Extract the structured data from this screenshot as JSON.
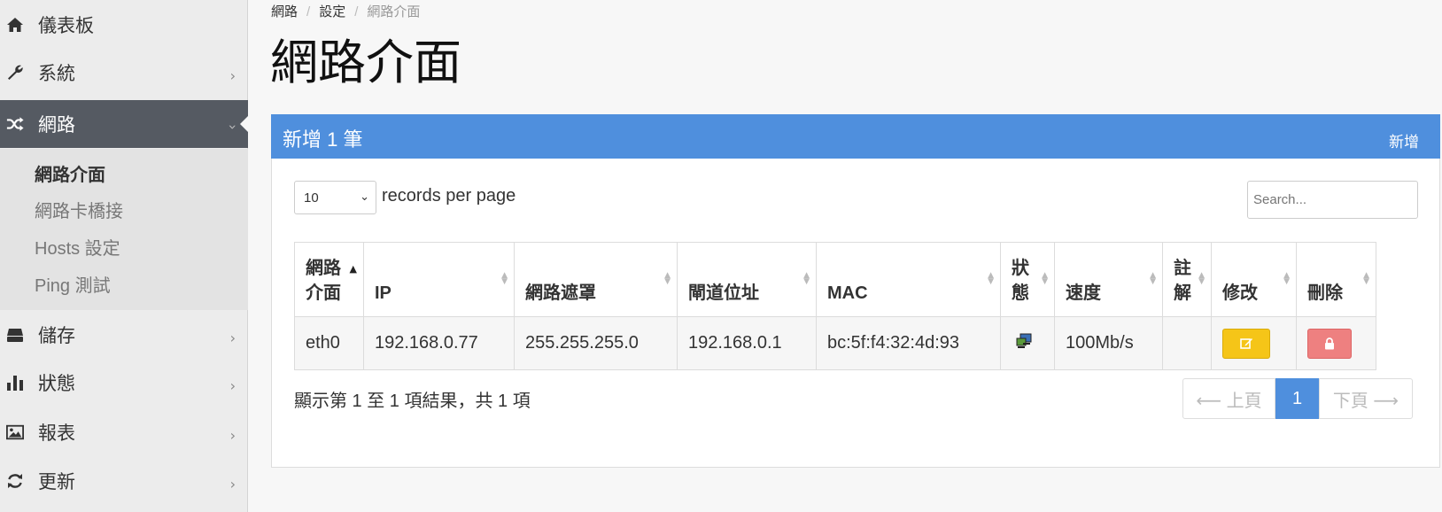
{
  "sidebar": {
    "items": [
      {
        "label": "儀表板",
        "icon": "home-icon"
      },
      {
        "label": "系統",
        "icon": "wrench-icon"
      },
      {
        "label": "網路",
        "icon": "shuffle-icon"
      },
      {
        "label": "儲存",
        "icon": "hdd-icon"
      },
      {
        "label": "狀態",
        "icon": "bar-chart-icon"
      },
      {
        "label": "報表",
        "icon": "image-icon"
      },
      {
        "label": "更新",
        "icon": "refresh-icon"
      }
    ],
    "network_sub": [
      "網路介面",
      "網路卡橋接",
      "Hosts 設定",
      "Ping 測試"
    ]
  },
  "breadcrumb": [
    "網路",
    "設定",
    "網路介面"
  ],
  "page_title": "網路介面",
  "panel": {
    "title": "新增 1 筆",
    "action": "新增"
  },
  "table_controls": {
    "rpp_value": "10",
    "rpp_label": "records per page",
    "search_placeholder": "Search..."
  },
  "table": {
    "headers": {
      "iface_1": "網路",
      "iface_2": "介面",
      "ip": "IP",
      "netmask": "網路遮罩",
      "gateway": "閘道位址",
      "mac": "MAC",
      "status_1": "狀",
      "status_2": "態",
      "speed": "速度",
      "note_1": "註",
      "note_2": "解",
      "edit": "修改",
      "delete": "刪除"
    },
    "rows": [
      {
        "iface": "eth0",
        "ip": "192.168.0.77",
        "netmask": "255.255.255.0",
        "gateway": "192.168.0.1",
        "mac": "bc:5f:f4:32:4d:93",
        "status_icon": "network-connected-icon",
        "speed": "100Mb/s",
        "note": ""
      }
    ]
  },
  "footer": {
    "info": "顯示第 1 至 1 項結果，共 1 項",
    "prev": "⟵ 上頁",
    "page": "1",
    "next": "下頁 ⟶"
  },
  "colors": {
    "panel_header": "#4f8fdd",
    "sidebar_active": "#555a62",
    "edit_button": "#f5c518",
    "delete_button": "#ee8080"
  }
}
